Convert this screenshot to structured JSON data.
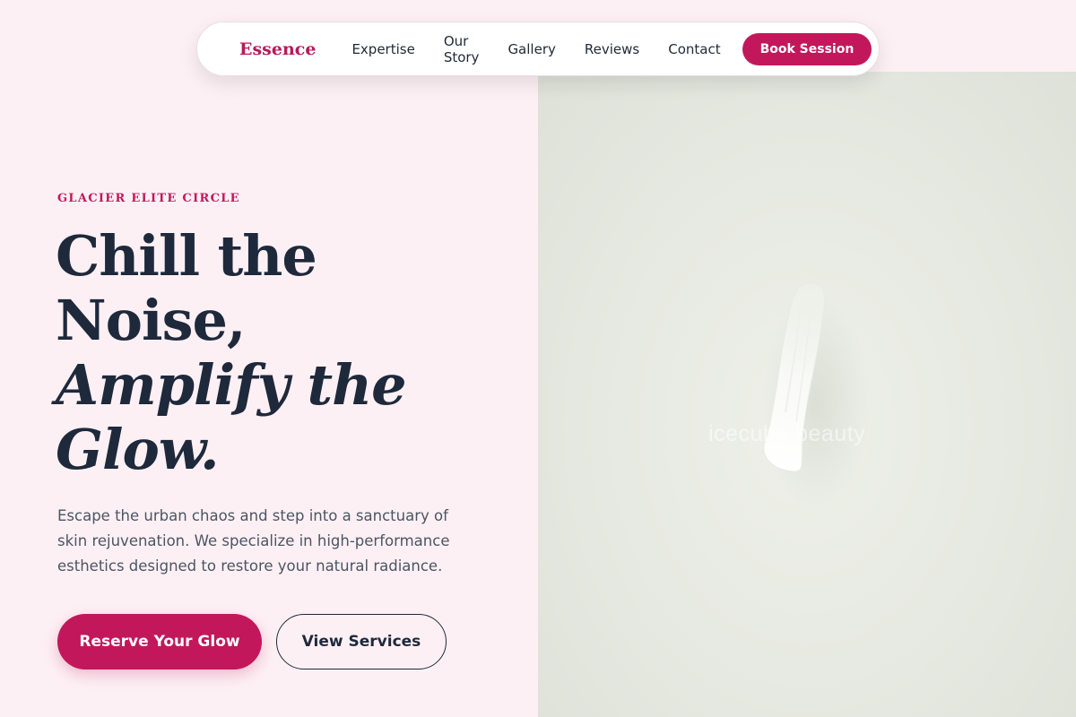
{
  "nav": {
    "logo": "Essence",
    "links": [
      "Expertise",
      "Our Story",
      "Gallery",
      "Reviews",
      "Contact"
    ],
    "book_label": "Book Session"
  },
  "hero": {
    "eyebrow": "GLACIER ELITE CIRCLE",
    "headline_lines": [
      "Chill the",
      "Noise,",
      "Amplify the",
      "Glow."
    ],
    "body": "Escape the urban chaos and step into a sanctuary of skin rejuvenation. We specialize in high-performance esthetics designed to restore your natural radiance.",
    "primary_cta": "Reserve Your Glow",
    "secondary_cta": "View Services",
    "image_watermark": "icecube beauty"
  },
  "colors": {
    "accent": "#c2185b",
    "page_bg": "#fdf0f4",
    "heading": "#1e293b",
    "body_text": "#4b5563"
  }
}
